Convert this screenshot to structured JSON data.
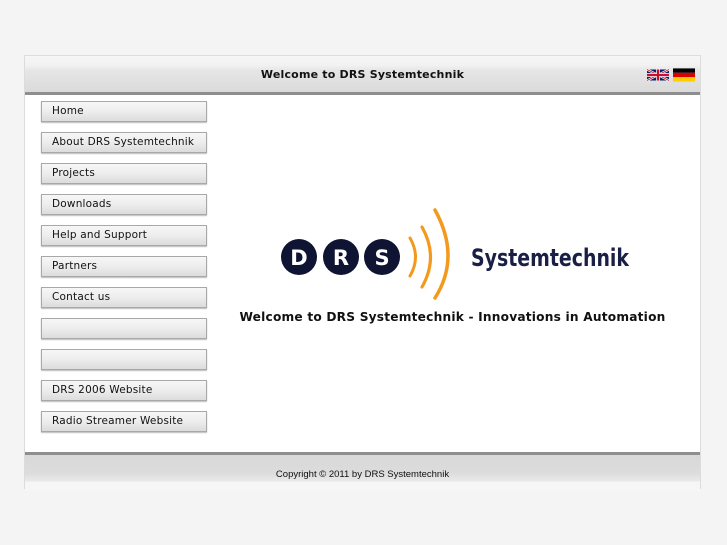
{
  "header": {
    "title": "Welcome to DRS Systemtechnik",
    "languages": [
      {
        "name": "English",
        "icon": "uk-flag-icon"
      },
      {
        "name": "Deutsch",
        "icon": "german-flag-icon"
      }
    ]
  },
  "nav": {
    "items": [
      {
        "label": "Home"
      },
      {
        "label": "About DRS Systemtechnik"
      },
      {
        "label": "Projects"
      },
      {
        "label": "Downloads"
      },
      {
        "label": "Help and Support"
      },
      {
        "label": "Partners"
      },
      {
        "label": "Contact us"
      },
      {
        "label": ""
      },
      {
        "label": ""
      },
      {
        "label": "DRS 2006 Website"
      },
      {
        "label": "Radio Streamer Website"
      }
    ]
  },
  "logo": {
    "letters": [
      "D",
      "R",
      "S"
    ],
    "wordmark": "Systemtechnik",
    "colors": {
      "circle": "#0f1433",
      "arc": "#f39a1e",
      "text": "#1a1f45"
    }
  },
  "main": {
    "tagline": "Welcome to DRS Systemtechnik - Innovations in Automation"
  },
  "footer": {
    "copyright": "Copyright © 2011 by DRS Systemtechnik"
  }
}
